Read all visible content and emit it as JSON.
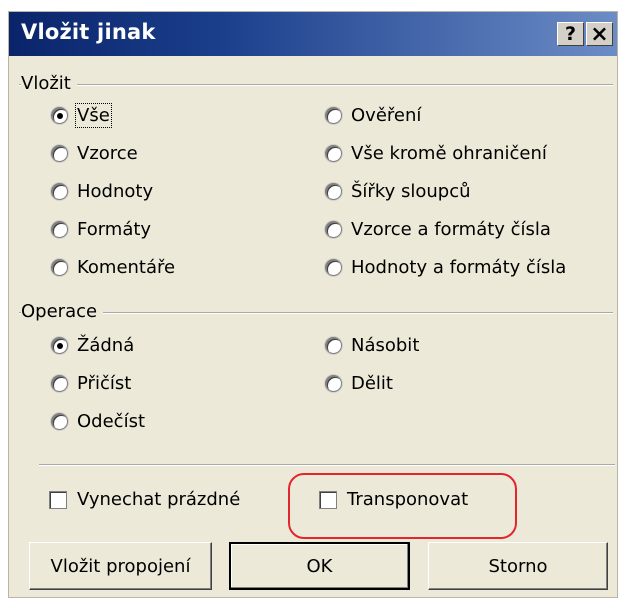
{
  "title": "Vložit jinak",
  "titlebar_buttons": {
    "help": "?",
    "close": "×"
  },
  "paste_group": {
    "label": "Vložit",
    "options": [
      {
        "label": "Vše",
        "selected": true
      },
      {
        "label": "Vzorce",
        "selected": false
      },
      {
        "label": "Hodnoty",
        "selected": false
      },
      {
        "label": "Formáty",
        "selected": false
      },
      {
        "label": "Komentáře",
        "selected": false
      },
      {
        "label": "Ověření",
        "selected": false
      },
      {
        "label": "Vše kromě ohraničení",
        "selected": false
      },
      {
        "label": "Šířky sloupců",
        "selected": false
      },
      {
        "label": "Vzorce a formáty čísla",
        "selected": false
      },
      {
        "label": "Hodnoty a formáty čísla",
        "selected": false
      }
    ]
  },
  "operation_group": {
    "label": "Operace",
    "options": [
      {
        "label": "Žádná",
        "selected": true
      },
      {
        "label": "Přičíst",
        "selected": false
      },
      {
        "label": "Odečíst",
        "selected": false
      },
      {
        "label": "Násobit",
        "selected": false
      },
      {
        "label": "Dělit",
        "selected": false
      }
    ]
  },
  "checkboxes": {
    "skip_blanks": {
      "label": "Vynechat prázdné",
      "checked": false
    },
    "transpose": {
      "label": "Transponovat",
      "checked": false
    }
  },
  "buttons": {
    "paste_link": "Vložit propojení",
    "ok": "OK",
    "cancel": "Storno"
  },
  "colors": {
    "title_bar_start": "#0a246a",
    "title_bar_end": "#6c8cc6",
    "dialog_bg": "#ece9d8",
    "highlight": "#e2262e"
  }
}
